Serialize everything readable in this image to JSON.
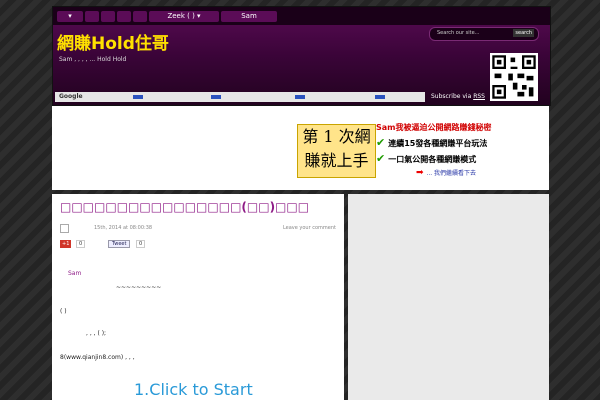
{
  "header": {
    "nav": [
      "▾",
      "",
      "",
      "",
      "",
      "Zeek  ( ) ▾",
      "Sam"
    ],
    "logo": "網賺Hold住哥",
    "description": "Sam       ,   ,  ,  ,  ...        Hold      Hold",
    "search_placeholder": "Search our site...",
    "search_button": "search",
    "google_label": "Google",
    "subscribe_text": "Subscribe via ",
    "rss_label": "RSS"
  },
  "banner": {
    "ad_box_line1": "第 1 次網",
    "ad_box_line2": "賺就上手",
    "title": "Sam我被逼迫公開網路賺錢秘密",
    "items": [
      "連續15發各種網賺平台玩法",
      "一口氣公開各種網賺模式"
    ],
    "more": "... 我們繼續看下去"
  },
  "post": {
    "title": "□□□□□□□□□□□□□□□□(□□)□□□",
    "date": "15th, 2014 at 08:00:38",
    "leave_comment": "Leave your comment",
    "gplus_label": "+1",
    "gplus_count": "0",
    "tweet_label": "Tweet",
    "tweet_count": "0",
    "lines": [
      "Sam",
      "~~~~~~~~~",
      "(    )",
      ",            ,          ,      (             );",
      "8(www.qianjin8.com)              ,         ,            ,"
    ],
    "cta": "1.Click to Start"
  },
  "colors": {
    "header_purple": "#3a0438",
    "logo_yellow": "#ffe100",
    "title_purple": "#8e1a86",
    "cta_blue": "#2a9ad8"
  }
}
